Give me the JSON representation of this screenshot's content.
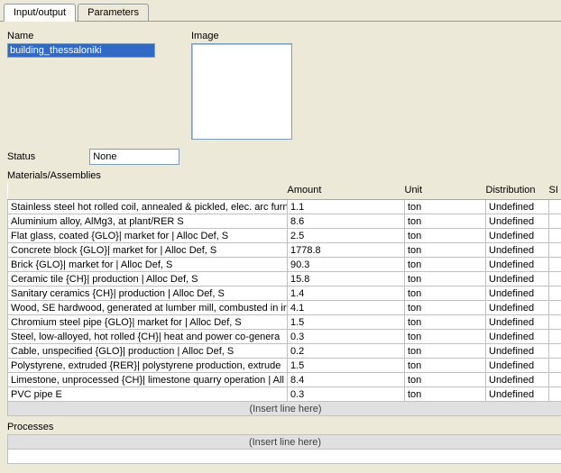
{
  "tabs": {
    "input_output": "Input/output",
    "parameters": "Parameters"
  },
  "labels": {
    "name": "Name",
    "image": "Image",
    "status": "Status",
    "materials": "Materials/Assemblies",
    "processes": "Processes",
    "insert": "(Insert line here)"
  },
  "fields": {
    "name_value": "building_thessaloniki",
    "status_value": "None"
  },
  "columns": {
    "material": "",
    "amount": "Amount",
    "unit": "Unit",
    "distribution": "Distribution",
    "last": "SI"
  },
  "rows": [
    {
      "mat": "Stainless steel hot rolled coil, annealed & pickled, elec. arc furn",
      "amt": "1.1",
      "unit": "ton",
      "dist": "Undefined"
    },
    {
      "mat": "Aluminium alloy, AlMg3, at plant/RER S",
      "amt": "8.6",
      "unit": "ton",
      "dist": "Undefined"
    },
    {
      "mat": "Flat glass, coated {GLO}| market for | Alloc Def, S",
      "amt": "2.5",
      "unit": "ton",
      "dist": "Undefined"
    },
    {
      "mat": "Concrete block {GLO}| market for | Alloc Def, S",
      "amt": "1778.8",
      "unit": "ton",
      "dist": "Undefined"
    },
    {
      "mat": "Brick {GLO}| market for | Alloc Def, S",
      "amt": "90.3",
      "unit": "ton",
      "dist": "Undefined"
    },
    {
      "mat": "Ceramic tile {CH}| production | Alloc Def, S",
      "amt": "15.8",
      "unit": "ton",
      "dist": "Undefined"
    },
    {
      "mat": "Sanitary ceramics {CH}| production | Alloc Def, S",
      "amt": "1.4",
      "unit": "ton",
      "dist": "Undefined"
    },
    {
      "mat": "Wood, SE hardwood, generated at lumber mill, combusted in ir",
      "amt": "4.1",
      "unit": "ton",
      "dist": "Undefined"
    },
    {
      "mat": "Chromium steel pipe {GLO}| market for | Alloc Def, S",
      "amt": "1.5",
      "unit": "ton",
      "dist": "Undefined"
    },
    {
      "mat": "Steel, low-alloyed, hot rolled {CH}| heat and power co-genera",
      "amt": "0.3",
      "unit": "ton",
      "dist": "Undefined"
    },
    {
      "mat": "Cable, unspecified {GLO}| production | Alloc Def, S",
      "amt": "0.2",
      "unit": "ton",
      "dist": "Undefined"
    },
    {
      "mat": "Polystyrene, extruded {RER}| polystyrene production, extrude",
      "amt": "1.5",
      "unit": "ton",
      "dist": "Undefined"
    },
    {
      "mat": "Limestone, unprocessed {CH}| limestone quarry operation | All",
      "amt": "8.4",
      "unit": "ton",
      "dist": "Undefined"
    },
    {
      "mat": "PVC pipe E",
      "amt": "0.3",
      "unit": "ton",
      "dist": "Undefined"
    }
  ]
}
